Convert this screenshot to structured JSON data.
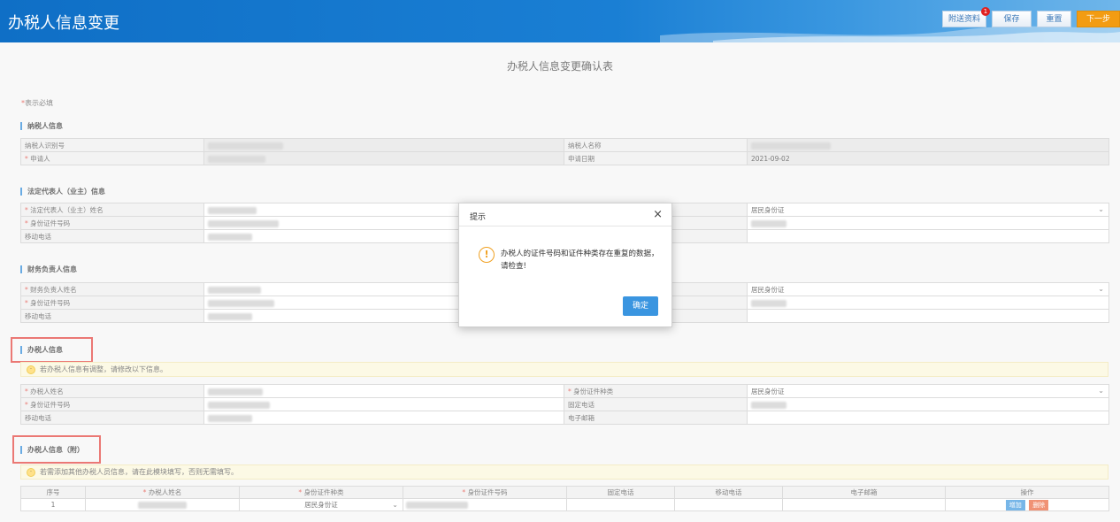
{
  "header": {
    "title": "办税人信息变更",
    "buttons": {
      "attach": "附送资料",
      "save": "保存",
      "reset": "重置",
      "next": "下一步"
    },
    "attach_badge": "1"
  },
  "form": {
    "title": "办税人信息变更确认表",
    "required_note": "表示必填",
    "required_mark": "*"
  },
  "taxpayer": {
    "section_title": "纳税人信息",
    "id_label": "纳税人识别号",
    "name_label": "纳税人名称",
    "applicant_label": "申请人",
    "apply_date_label": "申请日期",
    "apply_date": "2021-09-02"
  },
  "legal_rep": {
    "section_title": "法定代表人（业主）信息",
    "name_label": "法定代表人（业主）姓名",
    "id_no_label": "身份证件号码",
    "mobile_label": "移动电话",
    "id_type": "居民身份证"
  },
  "finance": {
    "section_title": "财务负责人信息",
    "name_label": "财务负责人姓名",
    "id_no_label": "身份证件号码",
    "mobile_label": "移动电话",
    "id_type": "居民身份证"
  },
  "agent": {
    "section_title": "办税人信息",
    "tip": "若办税人信息有调整，请修改以下信息。",
    "name_label": "办税人姓名",
    "id_type_label": "身份证件种类",
    "id_type": "居民身份证",
    "id_no_label": "身份证件号码",
    "phone_label": "固定电话",
    "mobile_label": "移动电话",
    "email_label": "电子邮箱"
  },
  "agent_extra": {
    "section_title": "办税人信息（附）",
    "tip": "若需添加其他办税人员信息，请在此模块填写，否则无需填写。",
    "columns": [
      "序号",
      "办税人姓名",
      "身份证件种类",
      "身份证件号码",
      "固定电话",
      "移动电话",
      "电子邮箱",
      "操作"
    ],
    "row": {
      "index": "1",
      "id_type": "居民身份证",
      "add": "增加",
      "delete": "删除"
    }
  },
  "dialog": {
    "title": "提示",
    "close": "×",
    "icon": "!",
    "message": "办税人的证件号码和证件种类存在重复的数据，请检查!",
    "ok": "确定"
  },
  "colors": {
    "header_blue": "#1a7fd4",
    "next_orange": "#f39c12",
    "required_red": "#e0352b"
  }
}
